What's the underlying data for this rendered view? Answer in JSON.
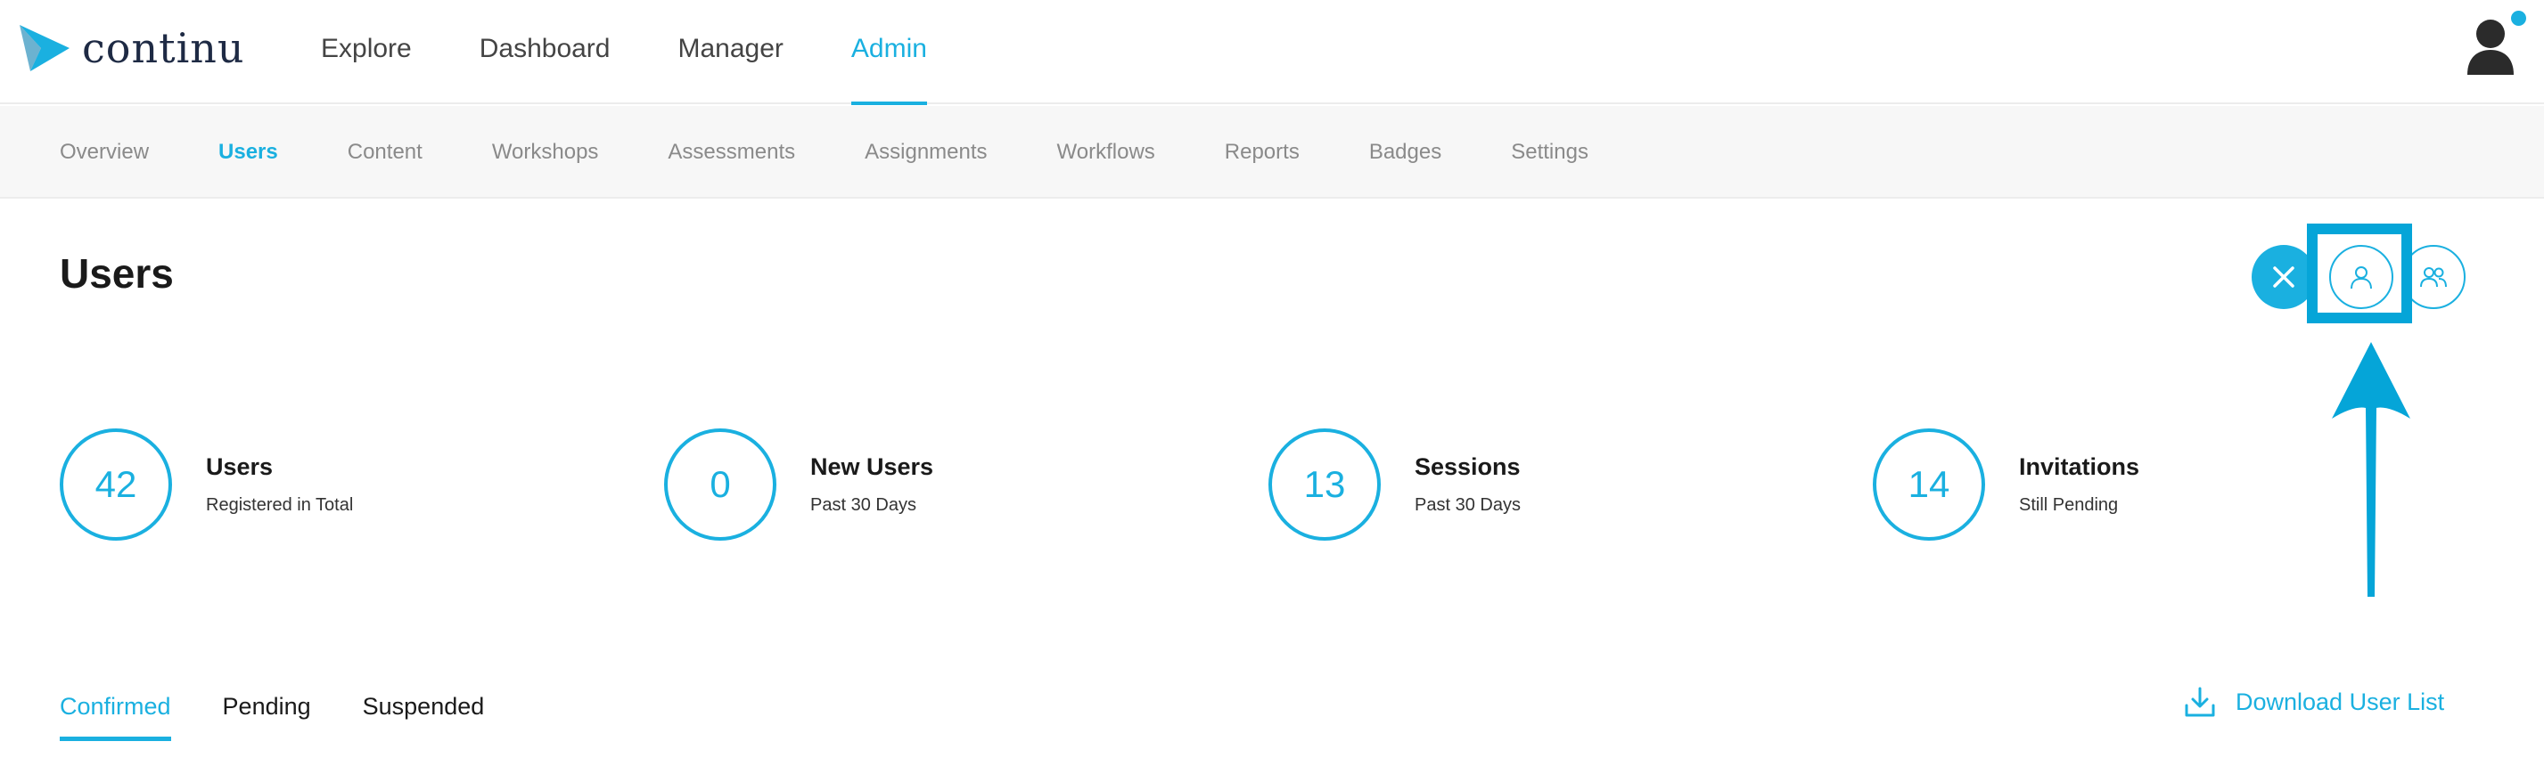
{
  "brand": {
    "logo_text": "continu",
    "accent": "#1ab0e0",
    "highlight": "#05a5d8"
  },
  "topnav": {
    "items": [
      {
        "label": "Explore",
        "active": false
      },
      {
        "label": "Dashboard",
        "active": false
      },
      {
        "label": "Manager",
        "active": false
      },
      {
        "label": "Admin",
        "active": true
      }
    ],
    "avatar_icon": "user-avatar-icon",
    "notification_dot": true
  },
  "subnav": {
    "items": [
      {
        "label": "Overview"
      },
      {
        "label": "Users",
        "active": true
      },
      {
        "label": "Content"
      },
      {
        "label": "Workshops"
      },
      {
        "label": "Assessments"
      },
      {
        "label": "Assignments"
      },
      {
        "label": "Workflows"
      },
      {
        "label": "Reports"
      },
      {
        "label": "Badges"
      },
      {
        "label": "Settings"
      }
    ]
  },
  "page": {
    "title": "Users"
  },
  "actions": {
    "close_icon": "close-icon",
    "add_user_icon": "user-icon",
    "add_group_icon": "group-icon"
  },
  "stats": [
    {
      "value": "42",
      "label": "Users",
      "sub": "Registered in Total"
    },
    {
      "value": "0",
      "label": "New Users",
      "sub": "Past 30 Days"
    },
    {
      "value": "13",
      "label": "Sessions",
      "sub": "Past 30 Days"
    },
    {
      "value": "14",
      "label": "Invitations",
      "sub": "Still Pending"
    }
  ],
  "tabs": [
    {
      "label": "Confirmed",
      "active": true
    },
    {
      "label": "Pending",
      "active": false
    },
    {
      "label": "Suspended",
      "active": false
    }
  ],
  "download": {
    "label": "Download User List",
    "icon": "download-icon"
  }
}
